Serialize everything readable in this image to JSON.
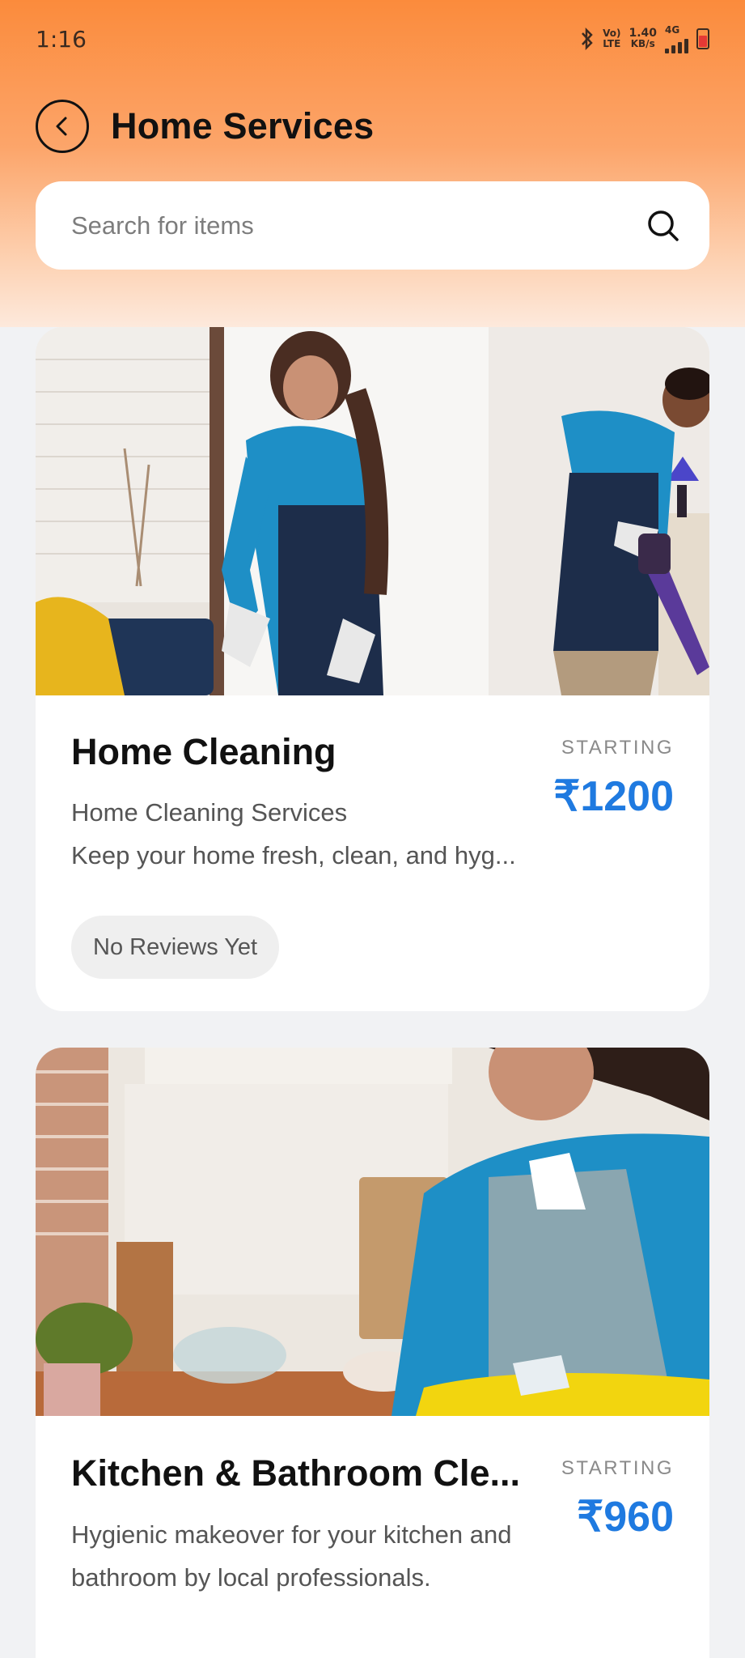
{
  "status_bar": {
    "time": "1:16",
    "network_label_top": "Vo)",
    "network_label_bottom": "LTE",
    "speed_value": "1.40",
    "speed_unit": "KB/s",
    "signal_type": "4G",
    "icons": [
      "bluetooth-icon",
      "signal-icon",
      "battery-icon"
    ]
  },
  "header": {
    "title": "Home Services",
    "back_icon": "chevron-left-icon"
  },
  "search": {
    "placeholder": "Search for items",
    "icon": "search-icon"
  },
  "services": [
    {
      "title": "Home Cleaning",
      "subtitle": "Home Cleaning Services",
      "description": "Keep your home fresh, clean, and hyg...",
      "starting_label": "STARTING",
      "price": "₹1200",
      "reviews_label": "No Reviews Yet"
    },
    {
      "title": "Kitchen & Bathroom Cle...",
      "description": "Hygienic makeover for your kitchen and bathroom by local professionals.",
      "starting_label": "STARTING",
      "price": "₹960"
    }
  ],
  "colors": {
    "header_gradient_top": "#fb8b3c",
    "price": "#1f7ae0",
    "background": "#f1f2f4"
  }
}
